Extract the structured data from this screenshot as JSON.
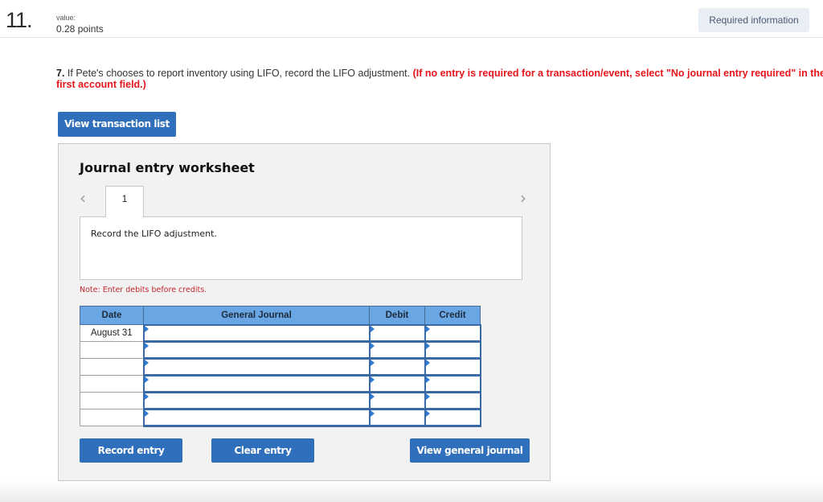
{
  "header": {
    "question_number": "11.",
    "value_label": "value:",
    "points": "0.28 points",
    "required_info_button": "Required information"
  },
  "question": {
    "number": "7.",
    "text": " If Pete's chooses to report inventory using LIFO, record the LIFO adjustment. ",
    "instruction": "(If no entry is required for a transaction/event, select \"No journal entry required\" in the first account field.)"
  },
  "buttons": {
    "view_transaction_list": "View transaction list",
    "record_entry": "Record entry",
    "clear_entry": "Clear entry",
    "view_general_journal": "View general journal"
  },
  "worksheet": {
    "title": "Journal entry worksheet",
    "prev_icon": "‹",
    "next_icon": "›",
    "active_tab": "1",
    "description": "Record the LIFO adjustment.",
    "note": "Note: Enter debits before credits.",
    "table": {
      "headers": [
        "Date",
        "General Journal",
        "Debit",
        "Credit"
      ],
      "rows": [
        {
          "date": "August 31",
          "account": "",
          "debit": "",
          "credit": ""
        },
        {
          "date": "",
          "account": "",
          "debit": "",
          "credit": ""
        },
        {
          "date": "",
          "account": "",
          "debit": "",
          "credit": ""
        },
        {
          "date": "",
          "account": "",
          "debit": "",
          "credit": ""
        },
        {
          "date": "",
          "account": "",
          "debit": "",
          "credit": ""
        },
        {
          "date": "",
          "account": "",
          "debit": "",
          "credit": ""
        }
      ]
    }
  }
}
